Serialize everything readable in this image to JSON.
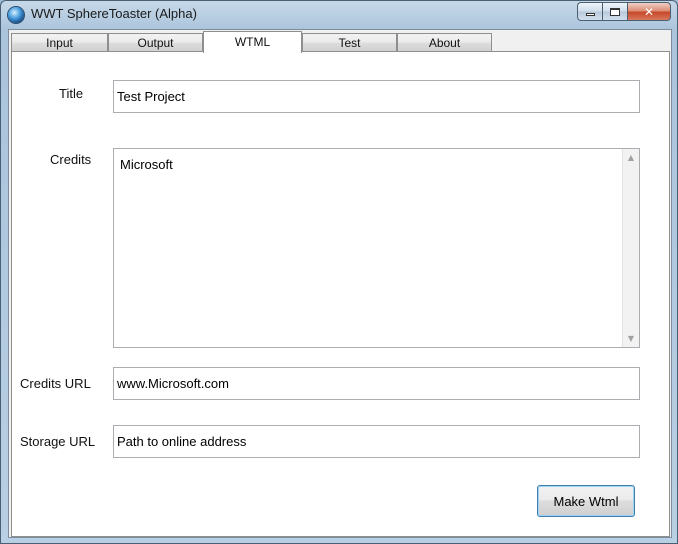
{
  "window": {
    "title": "WWT SphereToaster (Alpha)",
    "close_glyph": "✕"
  },
  "tabs": [
    {
      "label": "Input"
    },
    {
      "label": "Output"
    },
    {
      "label": "WTML"
    },
    {
      "label": "Test"
    },
    {
      "label": "About"
    }
  ],
  "active_tab": "WTML",
  "form": {
    "title_label": "Title",
    "title_value": "Test Project",
    "credits_label": "Credits",
    "credits_value": "Microsoft",
    "credits_url_label": "Credits URL",
    "credits_url_value": "www.Microsoft.com",
    "storage_url_label": "Storage URL",
    "storage_url_value": "Path to online address",
    "make_button_label": "Make Wtml"
  },
  "icons": {
    "app": "globe-icon",
    "minimize": "minimize-icon",
    "maximize": "maximize-icon",
    "close": "close-icon",
    "scroll_up": "chevron-up-icon",
    "scroll_down": "chevron-down-icon"
  }
}
